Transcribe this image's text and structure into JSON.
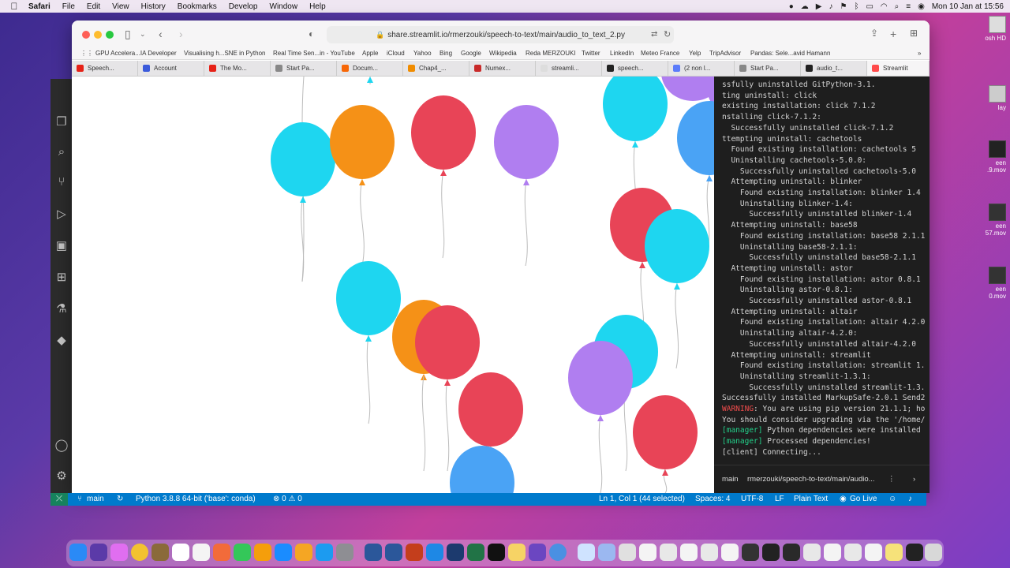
{
  "menubar": {
    "app_name": "Safari",
    "items": [
      "File",
      "Edit",
      "View",
      "History",
      "Bookmarks",
      "Develop",
      "Window",
      "Help"
    ],
    "clock": "Mon 10 Jan at 15:56"
  },
  "safari": {
    "url": "share.streamlit.io/rmerzouki/speech-to-text/main/audio_to_text_2.py",
    "favorites": [
      "GPU Accelera...IA Developer",
      "Visualising h...SNE in Python",
      "Real Time Sen...in - YouTube",
      "Apple",
      "iCloud",
      "Yahoo",
      "Bing",
      "Google",
      "Wikipedia",
      "Reda MERZOUKI",
      "Twitter",
      "LinkedIn",
      "Meteo France",
      "Yelp",
      "TripAdvisor",
      "Pandas: Sele...avid Hamann"
    ],
    "tabs": [
      {
        "label": "Speech...",
        "color": "#e62117"
      },
      {
        "label": "Account",
        "color": "#3b5bdb"
      },
      {
        "label": "The Mo...",
        "color": "#e62117"
      },
      {
        "label": "Start Pa...",
        "color": "#888888"
      },
      {
        "label": "Docum...",
        "color": "#f76707"
      },
      {
        "label": "Chap4_...",
        "color": "#f08c00"
      },
      {
        "label": "Numex...",
        "color": "#c92a2a"
      },
      {
        "label": "streamli...",
        "color": "#dddddd"
      },
      {
        "label": "speech...",
        "color": "#222222"
      },
      {
        "label": "(2 non l...",
        "color": "#5c7cfa"
      },
      {
        "label": "Start Pa...",
        "color": "#888888"
      },
      {
        "label": "audio_t...",
        "color": "#222222"
      },
      {
        "label": "Streamlit",
        "color": "#ff4b4b"
      }
    ]
  },
  "terminal": {
    "lines": [
      {
        "text": "ssfully uninstalled GitPython-3.1."
      },
      {
        "text": "ting uninstall: click"
      },
      {
        "text": "existing installation: click 7.1.2"
      },
      {
        "text": "nstalling click-7.1.2:"
      },
      {
        "text": "  Successfully uninstalled click-7.1.2"
      },
      {
        "text": "ttempting uninstall: cachetools"
      },
      {
        "text": "  Found existing installation: cachetools 5"
      },
      {
        "text": "  Uninstalling cachetools-5.0.0:"
      },
      {
        "text": "    Successfully uninstalled cachetools-5.0"
      },
      {
        "text": "  Attempting uninstall: blinker"
      },
      {
        "text": "    Found existing installation: blinker 1.4"
      },
      {
        "text": "    Uninstalling blinker-1.4:"
      },
      {
        "text": "      Successfully uninstalled blinker-1.4"
      },
      {
        "text": "  Attempting uninstall: base58"
      },
      {
        "text": "    Found existing installation: base58 2.1.1"
      },
      {
        "text": "    Uninstalling base58-2.1.1:"
      },
      {
        "text": "      Successfully uninstalled base58-2.1.1"
      },
      {
        "text": "  Attempting uninstall: astor"
      },
      {
        "text": "    Found existing installation: astor 0.8.1"
      },
      {
        "text": "    Uninstalling astor-0.8.1:"
      },
      {
        "text": "      Successfully uninstalled astor-0.8.1"
      },
      {
        "text": "  Attempting uninstall: altair"
      },
      {
        "text": "    Found existing installation: altair 4.2.0"
      },
      {
        "text": "    Uninstalling altair-4.2.0:"
      },
      {
        "text": "      Successfully uninstalled altair-4.2.0"
      },
      {
        "text": "  Attempting uninstall: streamlit"
      },
      {
        "text": "    Found existing installation: streamlit 1."
      },
      {
        "text": "    Uninstalling streamlit-1.3.1:"
      },
      {
        "text": "      Successfully uninstalled streamlit-1.3."
      },
      {
        "text": "Successfully installed MarkupSafe-2.0.1 Send2"
      },
      {
        "prefix": "WARNING",
        "text": ": You are using pip version 21.1.1; ho",
        "kind": "warn"
      },
      {
        "text": "You should consider upgrading via the '/home/"
      },
      {
        "prefix": "[manager]",
        "text": " Python dependencies were installed",
        "kind": "mgr"
      },
      {
        "prefix": "[manager]",
        "text": " Processed dependencies!",
        "kind": "mgr"
      },
      {
        "text": "[client] Connecting..."
      }
    ],
    "footer_branch": "main",
    "footer_path": "rmerzouki/speech-to-text/main/audio..."
  },
  "vscode_status": {
    "branch": "main",
    "python": "Python 3.8.8 64-bit ('base': conda)",
    "problems": "⊗ 0 ⚠ 0",
    "position": "Ln 1, Col 1 (44 selected)",
    "spaces": "Spaces: 4",
    "encoding": "UTF-8",
    "eol": "LF",
    "language": "Plain Text",
    "golive": "Go Live"
  },
  "desktop": {
    "items": [
      "osh HD",
      "lay",
      "een",
      ".9.mov",
      "een",
      "57.mov",
      "een",
      "0.mov"
    ]
  }
}
